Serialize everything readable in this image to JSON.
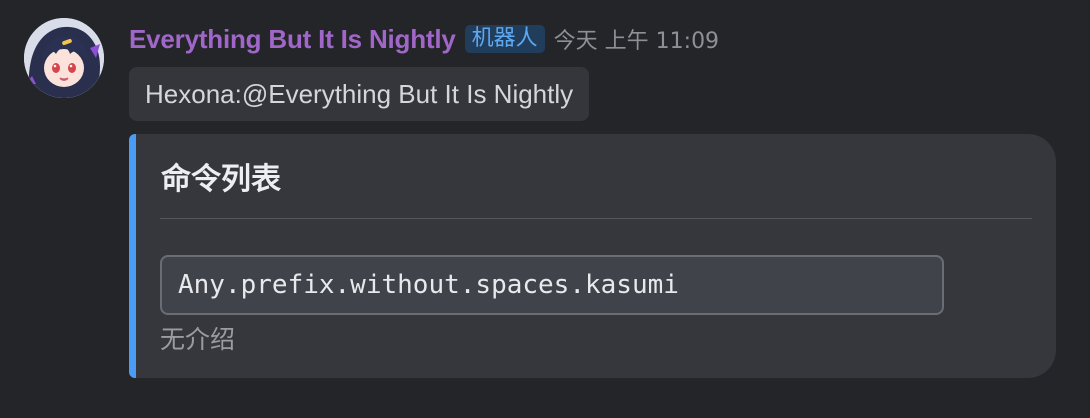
{
  "message": {
    "author": {
      "name": "Everything But It Is Nightly",
      "badge": "机器人",
      "name_color": "#a066c9"
    },
    "timestamp": "今天 上午 11:09",
    "text": "Hexona:@Everything But It Is Nightly",
    "embed": {
      "accent_color": "#4a9cf5",
      "title": "命令列表",
      "commands": [
        {
          "name": "Any.prefix.without.spaces.kasumi",
          "description": "无介绍"
        }
      ]
    }
  }
}
